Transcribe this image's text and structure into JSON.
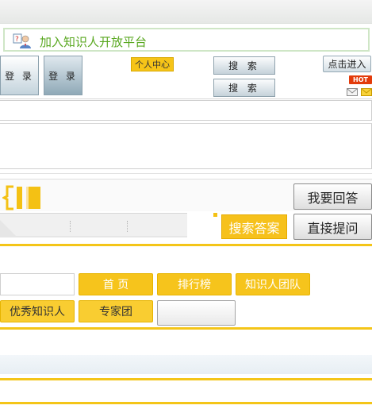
{
  "banner": {
    "title": "加入知识人开放平台",
    "icon": "knowledge-person-icon"
  },
  "login": {
    "button1": "登 录",
    "button2": "登 录"
  },
  "header": {
    "personal_center": "个人中心",
    "search1": "搜 索",
    "search2": "搜 索",
    "enter": "点击进入",
    "hot_badge": "HOT",
    "mail_icon": "mail-icon",
    "mail_icon_alt": "mail-open-icon"
  },
  "answer": {
    "logo_icon": "zhishiren-logo-icon",
    "want_to_answer": "我要回答",
    "search_answer": "搜索答案",
    "ask_directly": "直接提问"
  },
  "nav": {
    "items": [
      "首 页",
      "排行榜",
      "知识人团队",
      "优秀知识人",
      "专家团"
    ]
  },
  "colors": {
    "accent_yellow": "#f6c41c",
    "banner_green": "#58a71f",
    "hot_red": "#e33b0b"
  }
}
